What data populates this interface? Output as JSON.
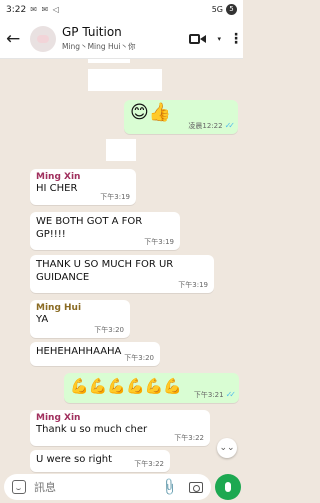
{
  "status_bar": {
    "time": "3:22",
    "left_icons": "✉ ✉ ◁",
    "right_text": "5G",
    "battery": "5"
  },
  "header": {
    "back": "←",
    "title": "GP Tuition",
    "subtitle": "Ming丶Ming Hui丶你",
    "chevron": "▾",
    "menu": "⋮"
  },
  "messages": [
    {
      "type": "out-emoji",
      "text": "😊👍",
      "time": "凌晨12:22",
      "ticks": "✓✓"
    },
    {
      "type": "in",
      "sender": "Ming Xin",
      "text": "HI CHER",
      "time": "下午3:19"
    },
    {
      "type": "in",
      "text": "WE BOTH GOT A FOR GP!!!!",
      "time": "下午3:19"
    },
    {
      "type": "in",
      "text": "THANK U SO MUCH FOR UR GUIDANCE",
      "time": "下午3:19"
    },
    {
      "type": "in",
      "sender": "Ming Hui",
      "text": "YA",
      "time": "下午3:20"
    },
    {
      "type": "in",
      "text": "HEHEHAHHAAHA",
      "time": "下午3:20"
    },
    {
      "type": "out-emoji",
      "text": "💪💪💪💪💪💪",
      "time": "下午3:21",
      "ticks": "✓✓"
    },
    {
      "type": "in",
      "sender": "Ming Xin",
      "text": "Thank u so much cher",
      "time": "下午3:22"
    },
    {
      "type": "in",
      "text": "U were so right",
      "time": "下午3:22"
    }
  ],
  "scroll_down": "⌄⌄",
  "input": {
    "placeholder": "訊息",
    "attach": "📎"
  },
  "colors": {
    "chat_bg": "#efe7de",
    "outgoing_bubble": "#d9fdd3",
    "incoming_bubble": "#ffffff",
    "mic_button": "#1da851",
    "read_ticks": "#53bdeb",
    "sender_ming_xin": "#a02f5d",
    "sender_ming_hui": "#8a6b23"
  }
}
